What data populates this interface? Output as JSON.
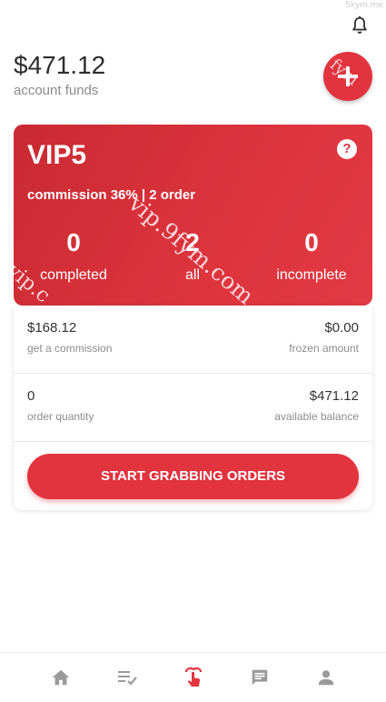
{
  "watermark": {
    "corner": "5kym.me",
    "card_diagonal": "vip.9fym.com",
    "card_left": "vip.c",
    "fab": "fym"
  },
  "account": {
    "funds_amount": "$471.12",
    "funds_label": "account funds"
  },
  "vip_card": {
    "level": "VIP5",
    "help_symbol": "?",
    "commission_text": "commission 36% | 2 order",
    "stats": [
      {
        "value": "0",
        "label": "completed"
      },
      {
        "value": "2",
        "label": "all"
      },
      {
        "value": "0",
        "label": "incomplete"
      }
    ]
  },
  "info": {
    "rows": [
      {
        "left": {
          "value": "$168.12",
          "label": "get a commission"
        },
        "right": {
          "value": "$0.00",
          "label": "frozen amount"
        }
      },
      {
        "left": {
          "value": "0",
          "label": "order quantity"
        },
        "right": {
          "value": "$471.12",
          "label": "available balance"
        }
      }
    ],
    "button_label": "START GRABBING ORDERS"
  },
  "tabbar": {
    "items": [
      {
        "icon": "home-icon",
        "active": false
      },
      {
        "icon": "order-list-icon",
        "active": false
      },
      {
        "icon": "grab-hand-icon",
        "active": true
      },
      {
        "icon": "message-icon",
        "active": false
      },
      {
        "icon": "user-icon",
        "active": false
      }
    ]
  },
  "colors": {
    "accent": "#e1343f",
    "icon_inactive": "#9a9a9a"
  }
}
